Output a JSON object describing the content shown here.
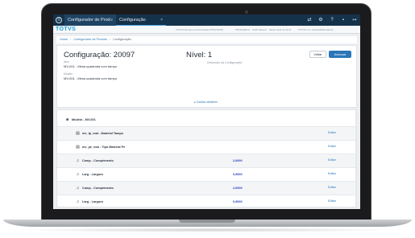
{
  "topbar": {
    "menu_icon": "menu-icon",
    "tabs": [
      {
        "label": "Configurador de Prod..",
        "close": "×"
      },
      {
        "label": "Configuração",
        "close": "×"
      }
    ],
    "right_icons": [
      "shuffle-icon",
      "gear-icon",
      "question-icon",
      "chat-icon",
      "logout-icon"
    ]
  },
  "brandbar": {
    "logo": "TOTVS",
    "info": [
      "TOTVS Serviços (Linha Datasul 05/12/2020)",
      "PRODAE5U1",
      "SSIP Datasul",
      "Medio Gold 11.01/11",
      "TOTVS S.A. Datasul/Manufatura"
    ]
  },
  "breadcrumb": {
    "items": [
      "Home",
      "Configurador de Produto",
      "Configuração"
    ],
    "separator": "/"
  },
  "header": {
    "title": "Configuração: 20097",
    "level": "Nível: 1",
    "description_label": "Descrição da Configuração",
    "item_label": "Item",
    "item_value": "MV-001 - Mesa quadrada com tampo",
    "model_label": "Modelo",
    "model_value": "MV-001 - Mesa quadrada com tampo",
    "back_button": "Voltar",
    "next_button": "Avançar",
    "hide_details": "▴ Ocultar detalhes"
  },
  "structure": {
    "model_row": {
      "label": "Modelo - MV-001",
      "icon": "cube-icon"
    },
    "rows": [
      {
        "label": "mv_tp_mat - Material Tampo",
        "value": "",
        "action": "Editar",
        "icon": "list-icon"
      },
      {
        "label": "mv_pe_mat - Tipo Material Pé",
        "value": "",
        "action": "Editar",
        "icon": "list-icon"
      },
      {
        "label": "Comp - Comprimento",
        "value": "2,0000",
        "action": "Editar",
        "icon": "bell-icon"
      },
      {
        "label": "Larg - Largura",
        "value": "0,9000",
        "action": "Editar",
        "icon": "bell-icon"
      },
      {
        "label": "Comp - Comprimento",
        "value": "2,0000",
        "action": "Editar",
        "icon": "bell-icon"
      },
      {
        "label": "Larg - Largura",
        "value": "0,9000",
        "action": "Editar",
        "icon": "bell-icon"
      }
    ]
  },
  "colors": {
    "topbar": "#15324b",
    "accent": "#2a76b8",
    "logo": "#1aa0d5",
    "value_text": "#1e3cc4"
  }
}
